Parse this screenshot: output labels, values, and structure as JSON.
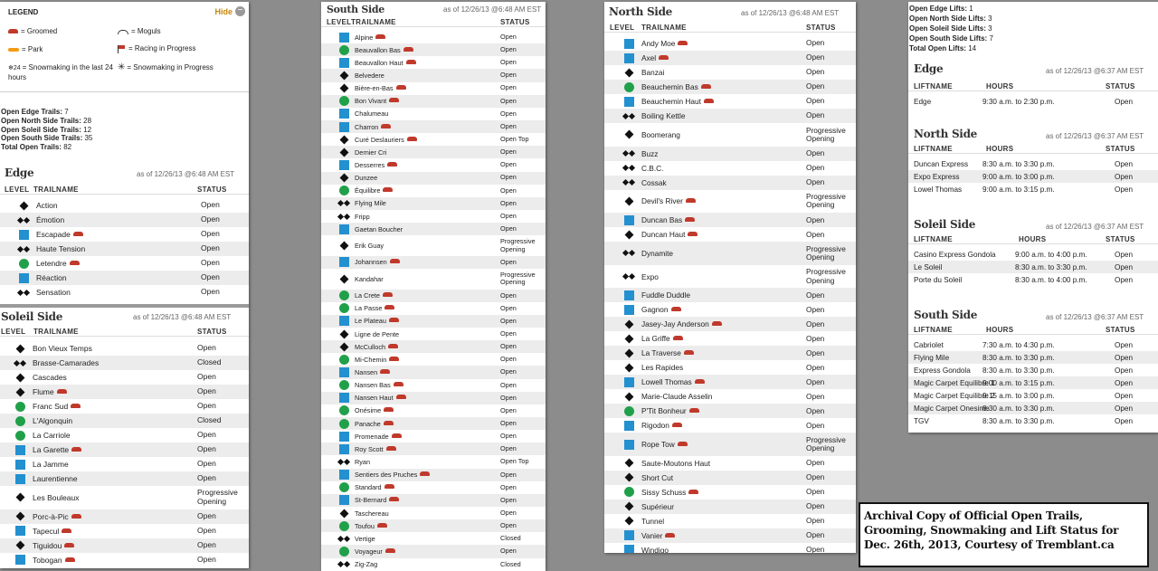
{
  "legend": {
    "title": "LEGEND",
    "hide_label": "Hide",
    "items": [
      {
        "label": "= Groomed"
      },
      {
        "label": "= Moguls"
      },
      {
        "label": "= Park"
      },
      {
        "label": "= Racing in Progress"
      },
      {
        "label": "= Snowmaking in the last 24 hours"
      },
      {
        "label": "= Snowmaking in Progress"
      }
    ]
  },
  "open_trails_summary": [
    {
      "label": "Open Edge Trails:",
      "value": "7"
    },
    {
      "label": "Open North Side Trails:",
      "value": "28"
    },
    {
      "label": "Open Soleil Side Trails:",
      "value": "12"
    },
    {
      "label": "Open South Side Trails:",
      "value": "35"
    },
    {
      "label": "Total Open Trails:",
      "value": "82"
    }
  ],
  "trail_headers": {
    "level": "LEVEL",
    "trailname": "TRAILNAME",
    "status": "STATUS"
  },
  "lift_headers": {
    "liftname": "LIFTNAME",
    "hours": "HOURS",
    "status": "STATUS"
  },
  "edge_trails": {
    "title": "Edge",
    "asof": "as of 12/26/13 @6:48 AM EST",
    "rows": [
      {
        "level": "black",
        "name": "Action",
        "groomed": false,
        "status": "Open"
      },
      {
        "level": "dbl",
        "name": "Émotion",
        "groomed": false,
        "status": "Open"
      },
      {
        "level": "blue",
        "name": "Escapade",
        "groomed": true,
        "status": "Open"
      },
      {
        "level": "dbl",
        "name": "Haute Tension",
        "groomed": false,
        "status": "Open"
      },
      {
        "level": "green",
        "name": "Letendre",
        "groomed": true,
        "status": "Open"
      },
      {
        "level": "blue",
        "name": "Réaction",
        "groomed": false,
        "status": "Open"
      },
      {
        "level": "dbl",
        "name": "Sensation",
        "groomed": false,
        "status": "Open"
      }
    ]
  },
  "soleil_trails": {
    "title": "Soleil Side",
    "asof": "as of 12/26/13 @6:48 AM EST",
    "rows": [
      {
        "level": "black",
        "name": "Bon Vieux Temps",
        "groomed": false,
        "status": "Open"
      },
      {
        "level": "dbl",
        "name": "Brasse-Camarades",
        "groomed": false,
        "status": "Closed"
      },
      {
        "level": "black",
        "name": "Cascades",
        "groomed": false,
        "status": "Open"
      },
      {
        "level": "black",
        "name": "Flume",
        "groomed": true,
        "status": "Open"
      },
      {
        "level": "green",
        "name": "Franc Sud",
        "groomed": true,
        "status": "Open"
      },
      {
        "level": "green",
        "name": "L'Algonquin",
        "groomed": false,
        "status": "Closed"
      },
      {
        "level": "green",
        "name": "La Carriole",
        "groomed": false,
        "status": "Open"
      },
      {
        "level": "blue",
        "name": "La Garette",
        "groomed": true,
        "status": "Open"
      },
      {
        "level": "blue",
        "name": "La Jamme",
        "groomed": false,
        "status": "Open"
      },
      {
        "level": "blue",
        "name": "Laurentienne",
        "groomed": false,
        "status": "Open"
      },
      {
        "level": "black",
        "name": "Les Bouleaux",
        "groomed": false,
        "status": "Progressive Opening"
      },
      {
        "level": "black",
        "name": "Porc-à-Pic",
        "groomed": true,
        "status": "Open"
      },
      {
        "level": "blue",
        "name": "Tapecul",
        "groomed": true,
        "status": "Open"
      },
      {
        "level": "black",
        "name": "Tiguidou",
        "groomed": true,
        "status": "Open"
      },
      {
        "level": "blue",
        "name": "Tobogan",
        "groomed": true,
        "status": "Open"
      }
    ]
  },
  "south_trails": {
    "title": "South Side",
    "asof": "as of 12/26/13 @6:48 AM EST",
    "rows": [
      {
        "level": "blue",
        "name": "Alpine",
        "groomed": true,
        "status": "Open"
      },
      {
        "level": "green",
        "name": "Beauvallon Bas",
        "groomed": true,
        "status": "Open"
      },
      {
        "level": "blue",
        "name": "Beauvallon Haut",
        "groomed": true,
        "status": "Open"
      },
      {
        "level": "black",
        "name": "Belvedere",
        "groomed": false,
        "status": "Open"
      },
      {
        "level": "black",
        "name": "Bière-en-Bas",
        "groomed": true,
        "status": "Open"
      },
      {
        "level": "green",
        "name": "Bon Vivant",
        "groomed": true,
        "status": "Open"
      },
      {
        "level": "blue",
        "name": "Chalumeau",
        "groomed": false,
        "status": "Open"
      },
      {
        "level": "blue",
        "name": "Charron",
        "groomed": true,
        "status": "Open"
      },
      {
        "level": "black",
        "name": "Curé Deslauriers",
        "groomed": true,
        "status": "Open Top"
      },
      {
        "level": "black",
        "name": "Dernier Cri",
        "groomed": false,
        "status": "Open"
      },
      {
        "level": "blue",
        "name": "Desserres",
        "groomed": true,
        "status": "Open"
      },
      {
        "level": "black",
        "name": "Dunzee",
        "groomed": false,
        "status": "Open"
      },
      {
        "level": "green",
        "name": "Équilibre",
        "groomed": true,
        "status": "Open"
      },
      {
        "level": "dbl",
        "name": "Flying Mile",
        "groomed": false,
        "status": "Open"
      },
      {
        "level": "dbl",
        "name": "Fripp",
        "groomed": false,
        "status": "Open"
      },
      {
        "level": "blue",
        "name": "Gaetan Boucher",
        "groomed": false,
        "status": "Open"
      },
      {
        "level": "black",
        "name": "Erik Guay",
        "groomed": false,
        "status": "Progressive Opening"
      },
      {
        "level": "blue",
        "name": "Johannsen",
        "groomed": true,
        "status": "Open"
      },
      {
        "level": "black",
        "name": "Kandahar",
        "groomed": false,
        "status": "Progressive Opening"
      },
      {
        "level": "green",
        "name": "La Crete",
        "groomed": true,
        "status": "Open"
      },
      {
        "level": "green",
        "name": "La Passe",
        "groomed": true,
        "status": "Open"
      },
      {
        "level": "blue",
        "name": "Le Plateau",
        "groomed": true,
        "status": "Open"
      },
      {
        "level": "black",
        "name": "Ligne de Pente",
        "groomed": false,
        "status": "Open"
      },
      {
        "level": "black",
        "name": "McCulloch",
        "groomed": true,
        "status": "Open"
      },
      {
        "level": "green",
        "name": "Mi-Chemin",
        "groomed": true,
        "status": "Open"
      },
      {
        "level": "blue",
        "name": "Nansen",
        "groomed": true,
        "status": "Open"
      },
      {
        "level": "green",
        "name": "Nansen Bas",
        "groomed": true,
        "status": "Open"
      },
      {
        "level": "blue",
        "name": "Nansen Haut",
        "groomed": true,
        "status": "Open"
      },
      {
        "level": "green",
        "name": "Onésime",
        "groomed": true,
        "status": "Open"
      },
      {
        "level": "green",
        "name": "Panache",
        "groomed": true,
        "status": "Open"
      },
      {
        "level": "blue",
        "name": "Promenade",
        "groomed": true,
        "status": "Open"
      },
      {
        "level": "blue",
        "name": "Roy Scott",
        "groomed": true,
        "status": "Open"
      },
      {
        "level": "dbl",
        "name": "Ryan",
        "groomed": false,
        "status": "Open Top"
      },
      {
        "level": "blue",
        "name": "Sentiers des Pruches",
        "groomed": true,
        "status": "Open"
      },
      {
        "level": "green",
        "name": "Standard",
        "groomed": true,
        "status": "Open"
      },
      {
        "level": "blue",
        "name": "St-Bernard",
        "groomed": true,
        "status": "Open"
      },
      {
        "level": "black",
        "name": "Taschereau",
        "groomed": false,
        "status": "Open"
      },
      {
        "level": "green",
        "name": "Toufou",
        "groomed": true,
        "status": "Open"
      },
      {
        "level": "dbl",
        "name": "Vertige",
        "groomed": false,
        "status": "Closed"
      },
      {
        "level": "green",
        "name": "Voyageur",
        "groomed": true,
        "status": "Open"
      },
      {
        "level": "dbl",
        "name": "Zig-Zag",
        "groomed": false,
        "status": "Closed"
      }
    ]
  },
  "north_trails": {
    "title": "North Side",
    "asof": "as of 12/26/13 @6:48 AM EST",
    "rows": [
      {
        "level": "blue",
        "name": "Andy Moe",
        "groomed": true,
        "status": "Open"
      },
      {
        "level": "blue",
        "name": "Axel",
        "groomed": true,
        "status": "Open"
      },
      {
        "level": "black",
        "name": "Banzai",
        "groomed": false,
        "status": "Open"
      },
      {
        "level": "green",
        "name": "Beauchemin Bas",
        "groomed": true,
        "status": "Open"
      },
      {
        "level": "blue",
        "name": "Beauchemin Haut",
        "groomed": true,
        "status": "Open"
      },
      {
        "level": "dbl",
        "name": "Boiling Kettle",
        "groomed": false,
        "status": "Open"
      },
      {
        "level": "black",
        "name": "Boomerang",
        "groomed": false,
        "status": "Progressive Opening"
      },
      {
        "level": "dbl",
        "name": "Buzz",
        "groomed": false,
        "status": "Open"
      },
      {
        "level": "dbl",
        "name": "C.B.C.",
        "groomed": false,
        "status": "Open"
      },
      {
        "level": "dbl",
        "name": "Cossak",
        "groomed": false,
        "status": "Open"
      },
      {
        "level": "black",
        "name": "Devil's River",
        "groomed": true,
        "status": "Progressive Opening"
      },
      {
        "level": "blue",
        "name": "Duncan Bas",
        "groomed": true,
        "status": "Open"
      },
      {
        "level": "black",
        "name": "Duncan Haut",
        "groomed": true,
        "status": "Open"
      },
      {
        "level": "dbl",
        "name": "Dynamite",
        "groomed": false,
        "status": "Progressive Opening"
      },
      {
        "level": "dbl",
        "name": "Expo",
        "groomed": false,
        "status": "Progressive Opening"
      },
      {
        "level": "blue",
        "name": "Fuddle Duddle",
        "groomed": false,
        "status": "Open"
      },
      {
        "level": "blue",
        "name": "Gagnon",
        "groomed": true,
        "status": "Open"
      },
      {
        "level": "black",
        "name": "Jasey-Jay Anderson",
        "groomed": true,
        "status": "Open"
      },
      {
        "level": "black",
        "name": "La Griffe",
        "groomed": true,
        "status": "Open"
      },
      {
        "level": "black",
        "name": "La Traverse",
        "groomed": true,
        "status": "Open"
      },
      {
        "level": "black",
        "name": "Les Rapides",
        "groomed": false,
        "status": "Open"
      },
      {
        "level": "blue",
        "name": "Lowell Thomas",
        "groomed": true,
        "status": "Open"
      },
      {
        "level": "black",
        "name": "Marie-Claude Asselin",
        "groomed": false,
        "status": "Open"
      },
      {
        "level": "green",
        "name": "P'Tit Bonheur",
        "groomed": true,
        "status": "Open"
      },
      {
        "level": "blue",
        "name": "Rigodon",
        "groomed": true,
        "status": "Open"
      },
      {
        "level": "blue",
        "name": "Rope Tow",
        "groomed": true,
        "status": "Progressive Opening"
      },
      {
        "level": "black",
        "name": "Saute-Moutons Haut",
        "groomed": false,
        "status": "Open"
      },
      {
        "level": "black",
        "name": "Short Cut",
        "groomed": false,
        "status": "Open"
      },
      {
        "level": "green",
        "name": "Sissy Schuss",
        "groomed": true,
        "status": "Open"
      },
      {
        "level": "black",
        "name": "Supérieur",
        "groomed": false,
        "status": "Open"
      },
      {
        "level": "black",
        "name": "Tunnel",
        "groomed": false,
        "status": "Open"
      },
      {
        "level": "blue",
        "name": "Vanier",
        "groomed": true,
        "status": "Open"
      },
      {
        "level": "blue",
        "name": "Windigo",
        "groomed": false,
        "status": "Open"
      }
    ]
  },
  "lifts_summary": [
    {
      "label": "Open Edge Lifts:",
      "value": "1"
    },
    {
      "label": "Open North Side Lifts:",
      "value": "3"
    },
    {
      "label": "Open Soleil Side Lifts:",
      "value": "3"
    },
    {
      "label": "Open South Side Lifts:",
      "value": "7"
    },
    {
      "label": "Total Open Lifts:",
      "value": "14"
    }
  ],
  "lift_sections": [
    {
      "title": "Edge",
      "asof": "as of 12/26/13 @6:37 AM EST",
      "rows": [
        {
          "name": "Edge",
          "hours": "9:30 a.m. to 2:30 p.m.",
          "status": "Open"
        }
      ]
    },
    {
      "title": "North Side",
      "asof": "as of 12/26/13 @6:37 AM EST",
      "rows": [
        {
          "name": "Duncan Express",
          "hours": "8:30 a.m. to 3:30 p.m.",
          "status": "Open"
        },
        {
          "name": "Expo Express",
          "hours": "9:00 a.m. to 3:00 p.m.",
          "status": "Open"
        },
        {
          "name": "Lowel Thomas",
          "hours": "9:00 a.m. to 3:15 p.m.",
          "status": "Open"
        }
      ]
    },
    {
      "title": "Soleil Side",
      "asof": "as of 12/26/13 @6:37 AM EST",
      "rows": [
        {
          "name": "Casino Express Gondola",
          "hours": "9:00 a.m. to 4:00 p.m.",
          "status": "Open"
        },
        {
          "name": "Le Soleil",
          "hours": "8:30 a.m. to 3:30 p.m.",
          "status": "Open"
        },
        {
          "name": "Porte du Soleil",
          "hours": "8:30 a.m. to 4:00 p.m.",
          "status": "Open"
        }
      ]
    },
    {
      "title": "South Side",
      "asof": "as of 12/26/13 @6:37 AM EST",
      "rows": [
        {
          "name": "Cabriolet",
          "hours": "7:30 a.m. to 4:30 p.m.",
          "status": "Open"
        },
        {
          "name": "Flying Mile",
          "hours": "8:30 a.m. to 3:30 p.m.",
          "status": "Open"
        },
        {
          "name": "Express Gondola",
          "hours": "8:30 a.m. to 3:30 p.m.",
          "status": "Open"
        },
        {
          "name": "Magic Carpet Equilibre 1",
          "hours": "9:00 a.m. to 3:15 p.m.",
          "status": "Open"
        },
        {
          "name": "Magic Carpet Equilibre 2",
          "hours": "9:15 a.m. to 3:00 p.m.",
          "status": "Open"
        },
        {
          "name": "Magic Carpet Onesime",
          "hours": "8:30 a.m. to 3:30 p.m.",
          "status": "Open"
        },
        {
          "name": "TGV",
          "hours": "8:30 a.m. to 3:30 p.m.",
          "status": "Open"
        }
      ]
    }
  ],
  "caption": "Archival Copy of Official Open Trails, Grooming, Snowmaking and Lift Status for Dec. 26th, 2013, Courtesy of Tremblant.ca",
  "colors": {
    "green": "#21a04a",
    "blue": "#2390cf",
    "black": "#111111",
    "groomed": "#c0392b",
    "park": "#f39c12"
  }
}
